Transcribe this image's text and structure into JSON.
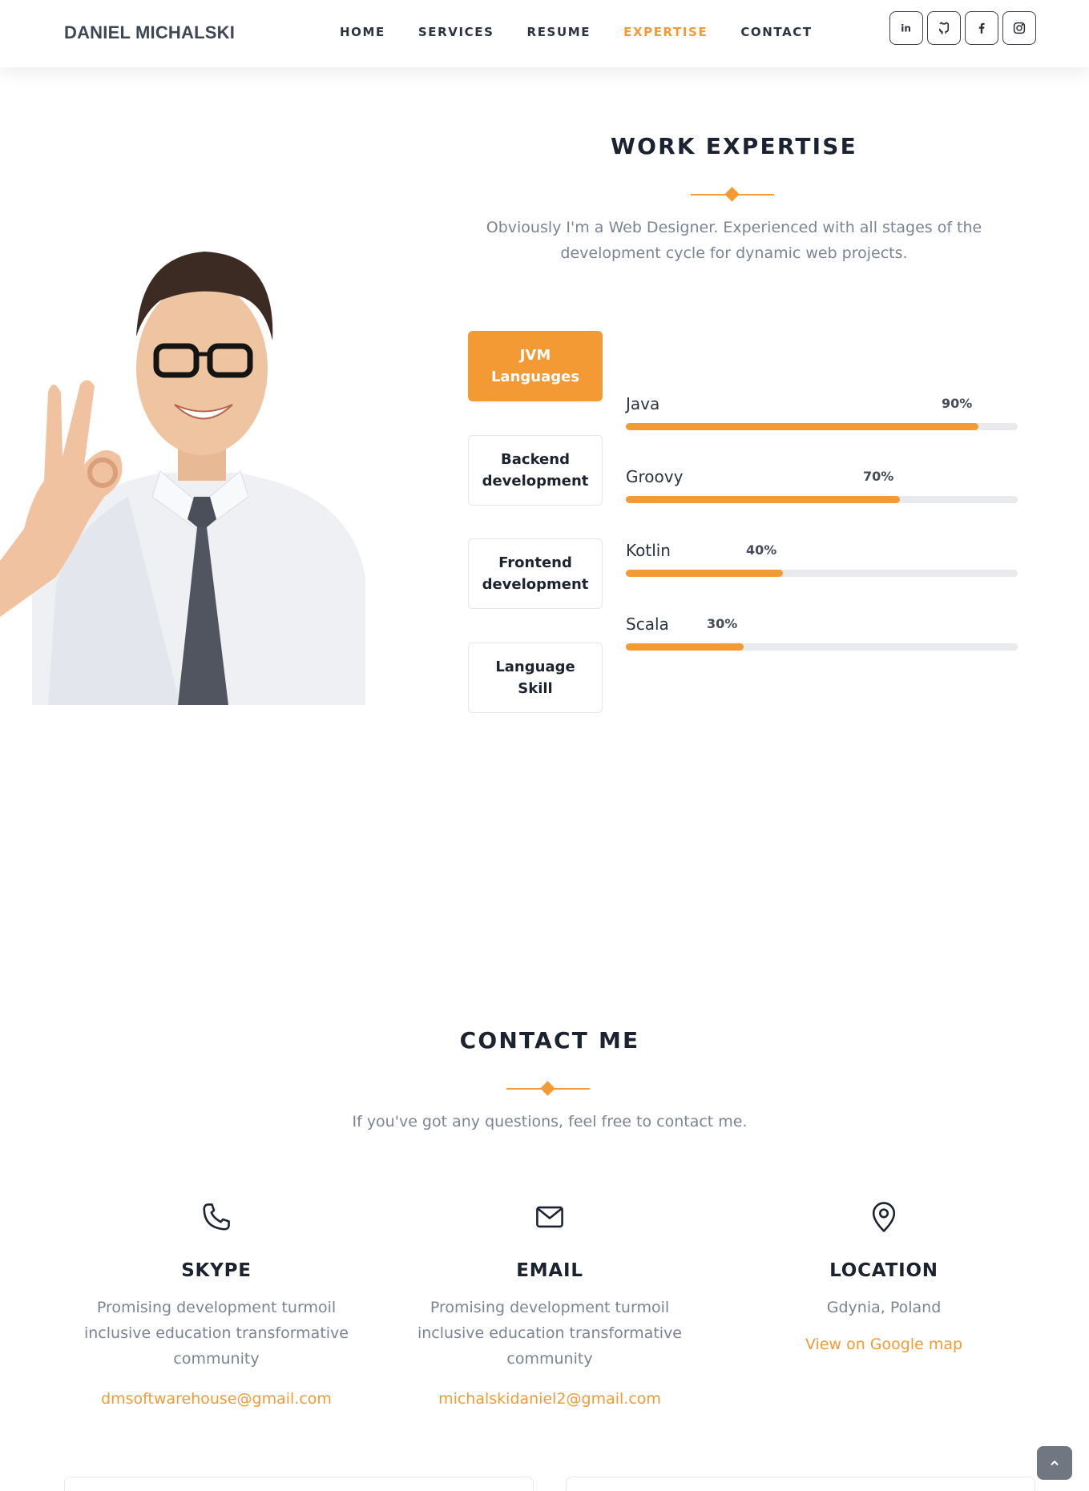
{
  "header": {
    "brand": "DANIEL MICHALSKI",
    "nav": [
      "HOME",
      "SERVICES",
      "RESUME",
      "EXPERTISE",
      "CONTACT"
    ],
    "active_nav": "EXPERTISE",
    "socials": [
      "linkedin-icon",
      "github-icon",
      "facebook-icon",
      "instagram-icon"
    ]
  },
  "expertise": {
    "title": "WORK EXPERTISE",
    "lead_line1": "Obviously I'm a Web Designer. Experienced with all stages of the",
    "lead_line2": "development cycle for dynamic web projects.",
    "tabs": [
      {
        "line1": "JVM",
        "line2": "Languages",
        "active": true
      },
      {
        "line1": "Backend",
        "line2": "development",
        "active": false
      },
      {
        "line1": "Frontend",
        "line2": "development",
        "active": false
      },
      {
        "line1": "Language",
        "line2": "Skill",
        "active": false
      }
    ],
    "skills": [
      {
        "name": "Java",
        "percent_label": "90%",
        "level": 0.9
      },
      {
        "name": "Groovy",
        "percent_label": "70%",
        "level": 0.7
      },
      {
        "name": "Kotlin",
        "percent_label": "40%",
        "level": 0.4
      },
      {
        "name": "Scala",
        "percent_label": "30%",
        "level": 0.3
      }
    ]
  },
  "contact": {
    "title": "CONTACT ME",
    "lead": "If you've got any questions, feel free to contact me.",
    "cards": [
      {
        "icon": "phone-icon",
        "title": "SKYPE",
        "text_line1": "Promising development turmoil",
        "text_line2": "inclusive education transformative",
        "text_line3": "community",
        "link": "dmsoftwarehouse@gmail.com"
      },
      {
        "icon": "mail-icon",
        "title": "EMAIL",
        "text_line1": "Promising development turmoil",
        "text_line2": "inclusive education transformative",
        "text_line3": "community",
        "link": "michalskidaniel2@gmail.com"
      },
      {
        "icon": "location-pin-icon",
        "title": "LOCATION",
        "text_line1": "Gdynia, Poland",
        "link": "View on Google map"
      }
    ]
  },
  "colors": {
    "accent": "#f39a34",
    "text_dark": "#1b2230",
    "text_muted": "#7b8495"
  }
}
